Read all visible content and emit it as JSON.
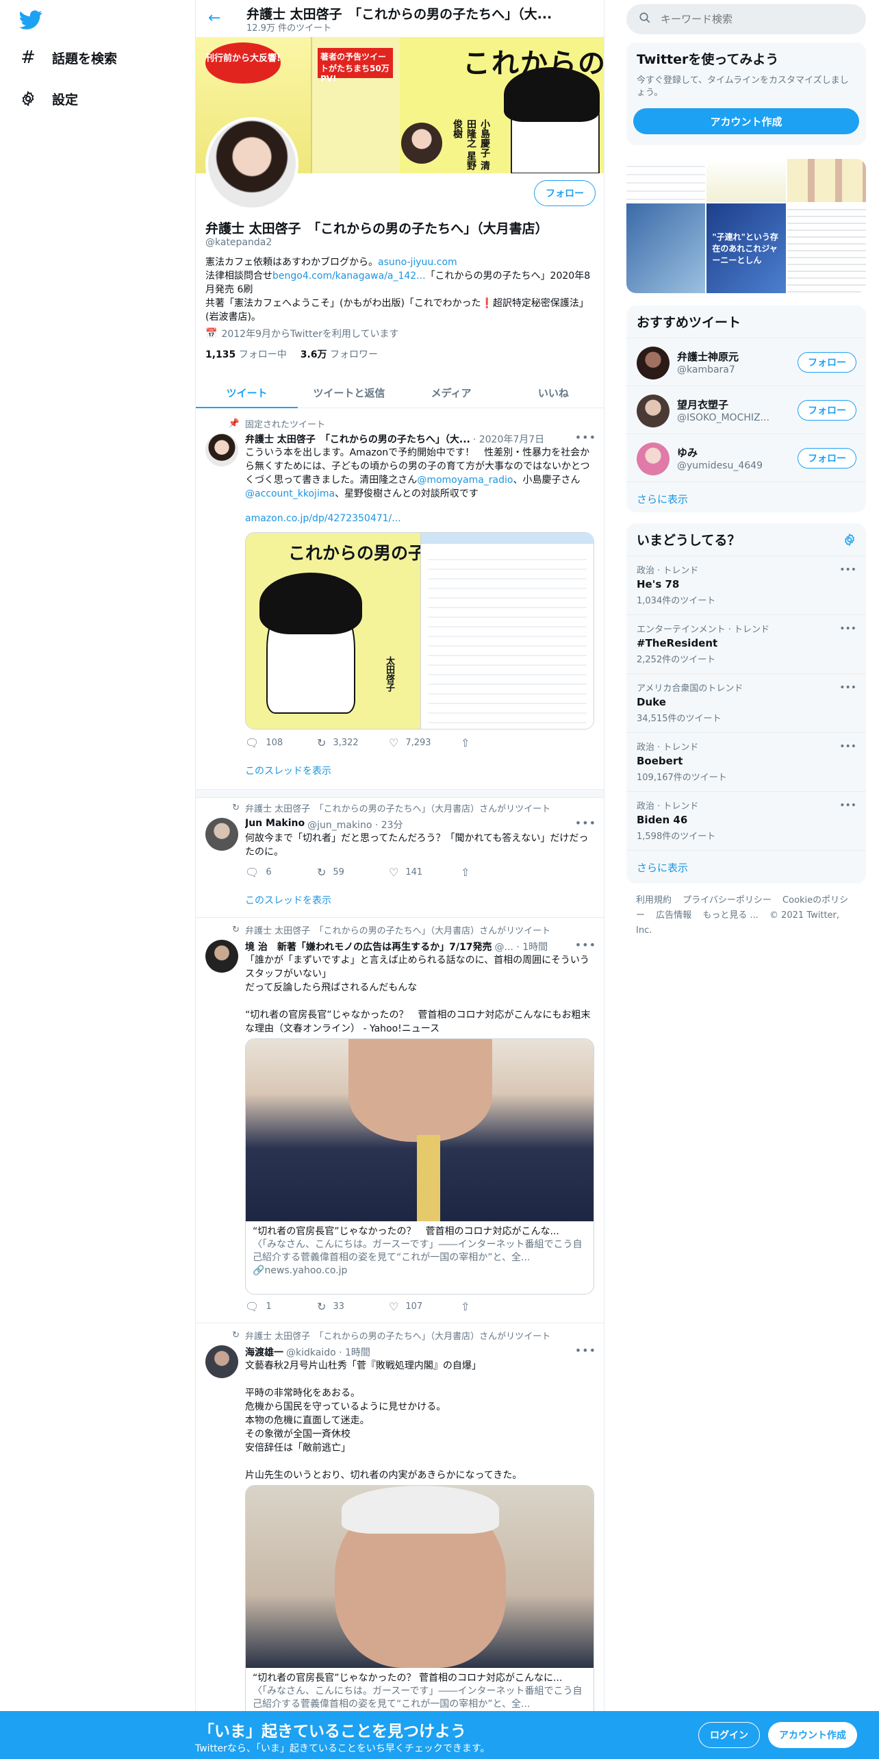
{
  "colors": {
    "accent": "#1da1f2",
    "link": "#1b95e0",
    "text": "#0f1419",
    "muted": "#657786"
  },
  "nav": {
    "logo_icon": "twitter-bird-icon",
    "items": [
      {
        "label": "話題を検索",
        "icon": "hashtag-icon"
      },
      {
        "label": "設定",
        "icon": "gear-icon"
      }
    ]
  },
  "header": {
    "name": "弁護士 太田啓子　「これからの男の子たちへ」（大...",
    "tweet_count": "12.9万 件のツイート"
  },
  "banner": {
    "title": "これからの男の子たちへ",
    "burst": "刊行前から大反響!",
    "redbox": "著者の予告ツイートがたちまち50万PV!",
    "authors": "小島慶子 清田隆之 星野俊樹"
  },
  "profile": {
    "follow_label": "フォロー",
    "name": "弁護士 太田啓子　「これからの男の子たちへ」（大月書店）",
    "handle": "@katepanda2",
    "bio_line1_pre": "憲法カフェ依頼はあすわかブログから。",
    "bio_link1": "asuno-jiyuu.com",
    "bio_line2_pre": "法律相談問合せ",
    "bio_link2": "bengo4.com/kanagawa/a_142...",
    "bio_line2_post": "「これからの男の子たちへ」2020年8月発売 6刷",
    "bio_line3": "共著「憲法カフェへようこそ」(かもがわ出版)「これでわかった❗超訳特定秘密保護法」(岩波書店)。",
    "joined": "2012年9月からTwitterを利用しています",
    "following_count": "1,135",
    "following_label": "フォロー中",
    "followers_count": "3.6万",
    "followers_label": "フォロワー"
  },
  "tabs": [
    "ツイート",
    "ツイートと返信",
    "メディア",
    "いいね"
  ],
  "tweets": [
    {
      "context": "固定されたツイート",
      "name": "弁護士 太田啓子　「これからの男の子たちへ」（大...",
      "meta": "· 2020年7月7日",
      "text_pre": "こういう本を出します。Amazonで予約開始中です！　性差別・性暴力を社会から無くすためには、子どもの頃からの男の子の育て方が大事なのではないかとつくづく思って書きました。清田隆之さん",
      "mention1": "@momoyama_radio",
      "text_mid": "、小島慶子さん",
      "mention2": "@account_kkojima",
      "text_post": "、星野俊樹さんとの対談所収です",
      "link": "amazon.co.jp/dp/4272350471/...",
      "replies": "108",
      "retweets": "3,322",
      "likes": "7,293",
      "thread": "このスレッドを表示",
      "media_title": "これからの男の子たちへ",
      "media_author": "太田啓子"
    },
    {
      "context": "弁護士 太田啓子　「これからの男の子たちへ」（大月書店）さんがリツイート",
      "name": "Jun Makino",
      "meta": "@jun_makino · 23分",
      "text": "何故今まで「切れ者」だと思ってたんだろう？「聞かれても答えない」だけだったのに。",
      "replies": "6",
      "retweets": "59",
      "likes": "141",
      "thread": "このスレッドを表示"
    },
    {
      "context": "弁護士 太田啓子　「これからの男の子たちへ」（大月書店）さんがリツイート",
      "name": "境 治　新著「嫌われモノの広告は再生するか」7/17発売",
      "meta": "@... · 1時間",
      "text": "「誰かが「まずいですよ」と言えば止められる話なのに、首相の周囲にそういうスタッフがいない」\nだって反論したら飛ばされるんだもんな\n\n“切れ者の官房長官”じゃなかったの？　菅首相のコロナ対応がこんなにもお粗末な理由（文春オンライン） - Yahoo!ニュース",
      "card_title": "“切れ者の官房長官”じゃなかったの？　菅首相のコロナ対応がこんな...",
      "card_desc": "〈「みなさん、こんにちは。ガースーです」――インターネット番組でこう自己紹介する菅義偉首相の姿を見て“これが一国の宰相か”と、全...",
      "card_url": "news.yahoo.co.jp",
      "replies": "1",
      "retweets": "33",
      "likes": "107"
    },
    {
      "context": "弁護士 太田啓子　「これからの男の子たちへ」（大月書店）さんがリツイート",
      "name": "海渡雄一",
      "meta": "@kidkaido · 1時間",
      "text": "文藝春秋2月号片山杜秀「菅『敗戦処理内閣』の自爆」\n\n平時の非常時化をあおる。\n危機から国民を守っているように見せかける。\n本物の危機に直面して迷走。\nその象徴が全国一斉休校\n安倍辞任は「敵前逃亡」\n\n片山先生のいうとおり、切れ者の内実があきらかになってきた。",
      "card_title": "“切れ者の官房長官”じゃなかったの？ 菅首相のコロナ対応がこんなに...",
      "card_desc": "〈「みなさん、こんにちは。ガースーです」――インターネット番組でこう自己紹介する菅義偉首相の姿を見て“これが一国の宰相か”と、全..."
    }
  ],
  "right": {
    "search_placeholder": "キーワード検索",
    "signup_title": "Twitterを使ってみよう",
    "signup_desc": "今すぐ登録して、タイムラインをカスタマイズしましょう。",
    "signup_button": "アカウント作成",
    "grid_text1": "\"子連れ\"という存在のあれこれジャーニーとしん",
    "who_title": "おすすめツイート",
    "who": [
      {
        "name": "弁護士神原元",
        "handle": "@kambara7",
        "follow": "フォロー"
      },
      {
        "name": "望月衣塑子",
        "handle": "@ISOKO_MOCHIZ...",
        "follow": "フォロー"
      },
      {
        "name": "ゆみ",
        "handle": "@yumidesu_4649",
        "follow": "フォロー"
      }
    ],
    "show_more": "さらに表示",
    "trends_title": "いまどうしてる？",
    "trends": [
      {
        "category": "政治 · トレンド",
        "name": "He's 78",
        "tweets": "1,034件のツイート"
      },
      {
        "category": "エンターテインメント · トレンド",
        "name": "#TheResident",
        "tweets": "2,252件のツイート"
      },
      {
        "category": "アメリカ合衆国のトレンド",
        "name": "Duke",
        "tweets": "34,515件のツイート"
      },
      {
        "category": "政治 · トレンド",
        "name": "Boebert",
        "tweets": "109,167件のツイート"
      },
      {
        "category": "政治 · トレンド",
        "name": "Biden 46",
        "tweets": "1,598件のツイート"
      }
    ],
    "footer": [
      "利用規約",
      "プライバシーポリシー",
      "Cookieのポリシー",
      "広告情報",
      "もっと見る ...",
      "© 2021 Twitter, Inc."
    ]
  },
  "bottombar": {
    "title": "「いま」起きていることを見つけよう",
    "subtitle": "Twitterなら、「いま」起きていることをいち早くチェックできます。",
    "login": "ログイン",
    "signup": "アカウント作成"
  }
}
